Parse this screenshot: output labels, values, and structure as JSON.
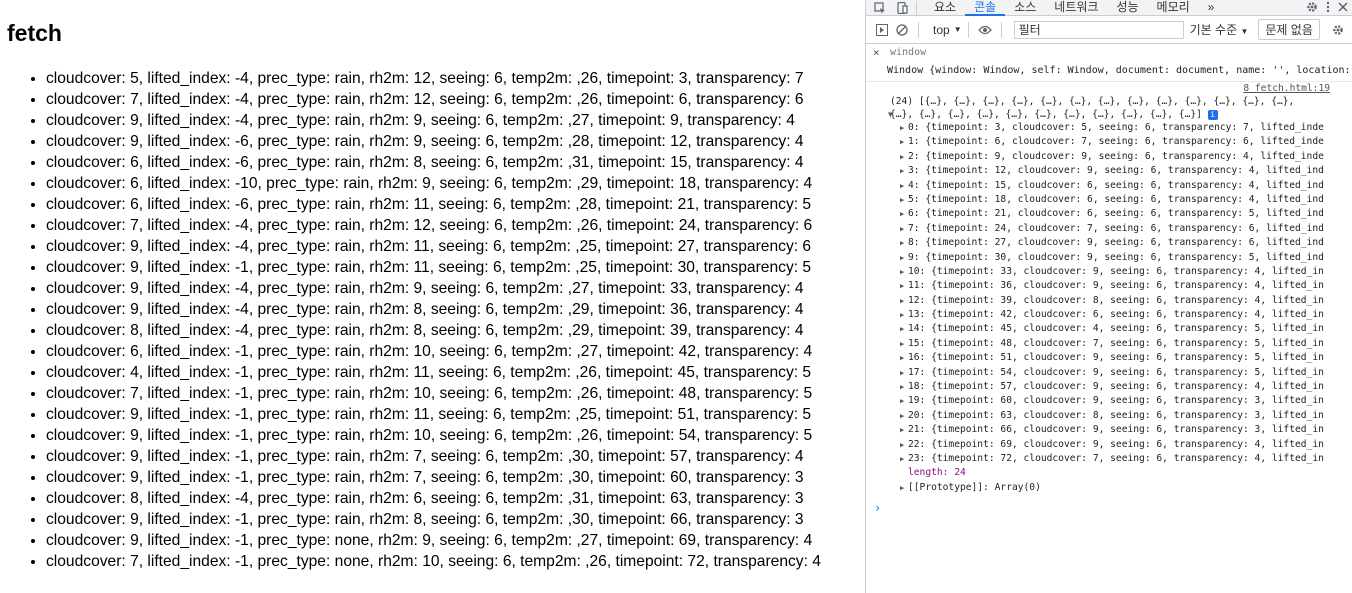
{
  "page": {
    "heading": "fetch",
    "items": [
      "cloudcover: 5, lifted_index: -4, prec_type: rain, rh2m: 12, seeing: 6, temp2m: ,26, timepoint: 3, transparency: 7",
      "cloudcover: 7, lifted_index: -4, prec_type: rain, rh2m: 12, seeing: 6, temp2m: ,26, timepoint: 6, transparency: 6",
      "cloudcover: 9, lifted_index: -4, prec_type: rain, rh2m: 9, seeing: 6, temp2m: ,27, timepoint: 9, transparency: 4",
      "cloudcover: 9, lifted_index: -6, prec_type: rain, rh2m: 9, seeing: 6, temp2m: ,28, timepoint: 12, transparency: 4",
      "cloudcover: 6, lifted_index: -6, prec_type: rain, rh2m: 8, seeing: 6, temp2m: ,31, timepoint: 15, transparency: 4",
      "cloudcover: 6, lifted_index: -10, prec_type: rain, rh2m: 9, seeing: 6, temp2m: ,29, timepoint: 18, transparency: 4",
      "cloudcover: 6, lifted_index: -6, prec_type: rain, rh2m: 11, seeing: 6, temp2m: ,28, timepoint: 21, transparency: 5",
      "cloudcover: 7, lifted_index: -4, prec_type: rain, rh2m: 12, seeing: 6, temp2m: ,26, timepoint: 24, transparency: 6",
      "cloudcover: 9, lifted_index: -4, prec_type: rain, rh2m: 11, seeing: 6, temp2m: ,25, timepoint: 27, transparency: 6",
      "cloudcover: 9, lifted_index: -1, prec_type: rain, rh2m: 11, seeing: 6, temp2m: ,25, timepoint: 30, transparency: 5",
      "cloudcover: 9, lifted_index: -4, prec_type: rain, rh2m: 9, seeing: 6, temp2m: ,27, timepoint: 33, transparency: 4",
      "cloudcover: 9, lifted_index: -4, prec_type: rain, rh2m: 8, seeing: 6, temp2m: ,29, timepoint: 36, transparency: 4",
      "cloudcover: 8, lifted_index: -4, prec_type: rain, rh2m: 8, seeing: 6, temp2m: ,29, timepoint: 39, transparency: 4",
      "cloudcover: 6, lifted_index: -1, prec_type: rain, rh2m: 10, seeing: 6, temp2m: ,27, timepoint: 42, transparency: 4",
      "cloudcover: 4, lifted_index: -1, prec_type: rain, rh2m: 11, seeing: 6, temp2m: ,26, timepoint: 45, transparency: 5",
      "cloudcover: 7, lifted_index: -1, prec_type: rain, rh2m: 10, seeing: 6, temp2m: ,26, timepoint: 48, transparency: 5",
      "cloudcover: 9, lifted_index: -1, prec_type: rain, rh2m: 11, seeing: 6, temp2m: ,25, timepoint: 51, transparency: 5",
      "cloudcover: 9, lifted_index: -1, prec_type: rain, rh2m: 10, seeing: 6, temp2m: ,26, timepoint: 54, transparency: 5",
      "cloudcover: 9, lifted_index: -1, prec_type: rain, rh2m: 7, seeing: 6, temp2m: ,30, timepoint: 57, transparency: 4",
      "cloudcover: 9, lifted_index: -1, prec_type: rain, rh2m: 7, seeing: 6, temp2m: ,30, timepoint: 60, transparency: 3",
      "cloudcover: 8, lifted_index: -4, prec_type: rain, rh2m: 6, seeing: 6, temp2m: ,31, timepoint: 63, transparency: 3",
      "cloudcover: 9, lifted_index: -1, prec_type: rain, rh2m: 8, seeing: 6, temp2m: ,30, timepoint: 66, transparency: 3",
      "cloudcover: 9, lifted_index: -1, prec_type: none, rh2m: 9, seeing: 6, temp2m: ,27, timepoint: 69, transparency: 4",
      "cloudcover: 7, lifted_index: -1, prec_type: none, rh2m: 10, seeing: 6, temp2m: ,26, timepoint: 72, transparency: 4"
    ]
  },
  "devtools": {
    "tabs": [
      "요소",
      "콘솔",
      "소스",
      "네트워크",
      "성능",
      "메모리"
    ],
    "active_tab": "콘솔",
    "more_tabs": "»",
    "context": "top",
    "filter_placeholder": "필터",
    "levels": "기본 수준",
    "issues": "문제 없음",
    "command": "window",
    "result_line": "Window {window: Window, self: Window, document: document, name: '', location:",
    "source_link": "8 fetch.html:19",
    "array_head": "(24) [{…}, {…}, {…}, {…}, {…}, {…}, {…}, {…}, {…}, {…}, {…}, {…}, {…},",
    "array_head2": "{…}, {…}, {…}, {…}, {…}, {…}, {…}, {…}, {…}, {…}, {…}]",
    "entries": [
      "0: {timepoint: 3, cloudcover: 5, seeing: 6, transparency: 7, lifted_inde",
      "1: {timepoint: 6, cloudcover: 7, seeing: 6, transparency: 6, lifted_inde",
      "2: {timepoint: 9, cloudcover: 9, seeing: 6, transparency: 4, lifted_inde",
      "3: {timepoint: 12, cloudcover: 9, seeing: 6, transparency: 4, lifted_ind",
      "4: {timepoint: 15, cloudcover: 6, seeing: 6, transparency: 4, lifted_ind",
      "5: {timepoint: 18, cloudcover: 6, seeing: 6, transparency: 4, lifted_ind",
      "6: {timepoint: 21, cloudcover: 6, seeing: 6, transparency: 5, lifted_ind",
      "7: {timepoint: 24, cloudcover: 7, seeing: 6, transparency: 6, lifted_ind",
      "8: {timepoint: 27, cloudcover: 9, seeing: 6, transparency: 6, lifted_ind",
      "9: {timepoint: 30, cloudcover: 9, seeing: 6, transparency: 5, lifted_ind",
      "10: {timepoint: 33, cloudcover: 9, seeing: 6, transparency: 4, lifted_in",
      "11: {timepoint: 36, cloudcover: 9, seeing: 6, transparency: 4, lifted_in",
      "12: {timepoint: 39, cloudcover: 8, seeing: 6, transparency: 4, lifted_in",
      "13: {timepoint: 42, cloudcover: 6, seeing: 6, transparency: 4, lifted_in",
      "14: {timepoint: 45, cloudcover: 4, seeing: 6, transparency: 5, lifted_in",
      "15: {timepoint: 48, cloudcover: 7, seeing: 6, transparency: 5, lifted_in",
      "16: {timepoint: 51, cloudcover: 9, seeing: 6, transparency: 5, lifted_in",
      "17: {timepoint: 54, cloudcover: 9, seeing: 6, transparency: 5, lifted_in",
      "18: {timepoint: 57, cloudcover: 9, seeing: 6, transparency: 4, lifted_in",
      "19: {timepoint: 60, cloudcover: 9, seeing: 6, transparency: 3, lifted_in",
      "20: {timepoint: 63, cloudcover: 8, seeing: 6, transparency: 3, lifted_in",
      "21: {timepoint: 66, cloudcover: 9, seeing: 6, transparency: 3, lifted_in",
      "22: {timepoint: 69, cloudcover: 9, seeing: 6, transparency: 4, lifted_in",
      "23: {timepoint: 72, cloudcover: 7, seeing: 6, transparency: 4, lifted_in"
    ],
    "length_line": "length: 24",
    "prototype_line": "[[Prototype]]: Array(0)",
    "prompt": "›",
    "colors": {
      "accent": "#1a73e8",
      "key_purple": "#881280",
      "number_blue": "#1c00cf",
      "string_red": "#c41a16"
    },
    "icons": [
      "inspect-icon",
      "device-icon",
      "settings-icon",
      "kebab-menu-icon",
      "close-icon",
      "sidebar-toggle-icon",
      "clear-console-icon",
      "eye-icon",
      "console-settings-icon"
    ]
  }
}
